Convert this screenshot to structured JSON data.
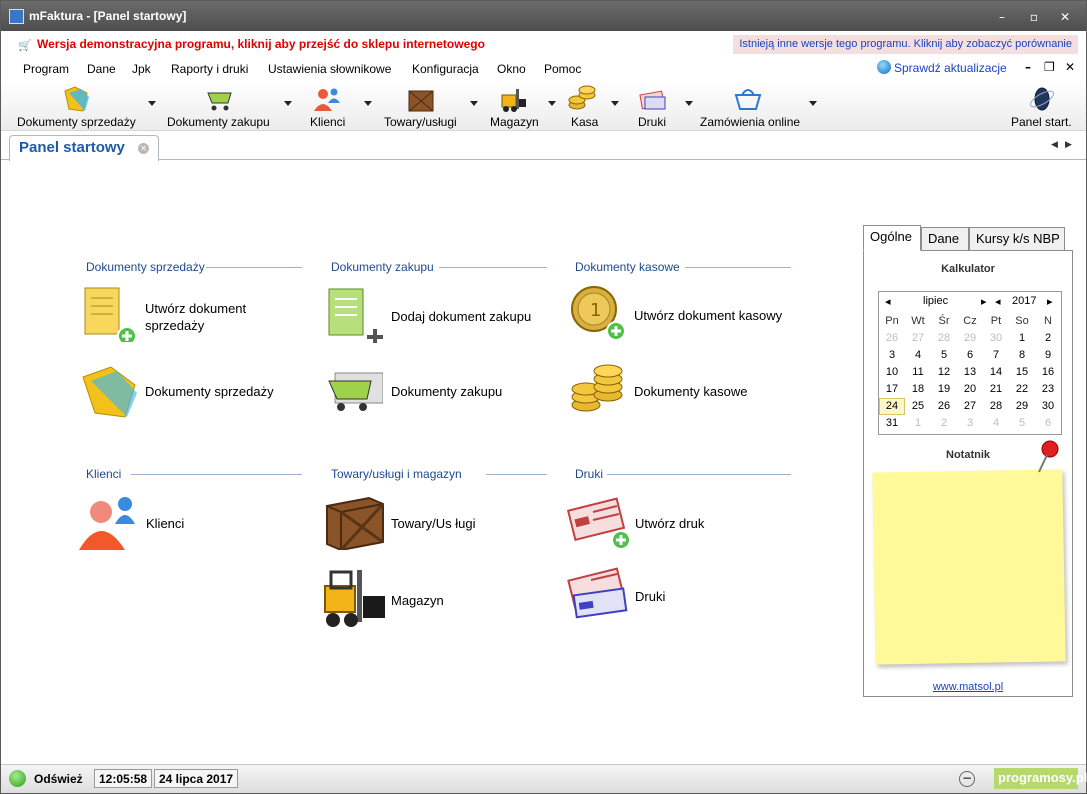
{
  "window": {
    "title": "mFaktura - [Panel startowy]"
  },
  "demo": {
    "link": "Wersja demonstracyjna programu, kliknij aby przejść do sklepu internetowego",
    "compare": "Istnieją inne wersje tego programu. Kliknij aby zobaczyć porównanie"
  },
  "menu": {
    "items": [
      "Program",
      "Dane",
      "Jpk",
      "Raporty i druki",
      "Ustawienia słownikowe",
      "Konfiguracja",
      "Okno",
      "Pomoc"
    ],
    "update": "Sprawdź aktualizacje"
  },
  "toolbar": {
    "buttons": [
      "Dokumenty sprzedaży",
      "Dokumenty zakupu",
      "Klienci",
      "Towary/usługi",
      "Magazyn",
      "Kasa",
      "Druki",
      "Zamówienia online",
      "Panel start."
    ]
  },
  "tabs": {
    "active": "Panel startowy"
  },
  "sections": {
    "sales": {
      "title": "Dokumenty sprzedaży",
      "create": "Utwórz dokument\nsprzedaży",
      "list": "Dokumenty sprzedaży"
    },
    "purchase": {
      "title": "Dokumenty zakupu",
      "create": "Dodaj dokument zakupu",
      "list": "Dokumenty zakupu"
    },
    "cash": {
      "title": "Dokumenty kasowe",
      "create": "Utwórz dokument kasowy",
      "list": "Dokumenty kasowe"
    },
    "clients": {
      "title": "Klienci",
      "list": "Klienci"
    },
    "goods": {
      "title": "Towary/usługi i magazyn",
      "goods": "Towary/Us ługi",
      "warehouse": "Magazyn"
    },
    "prints": {
      "title": "Druki",
      "create": "Utwórz druk",
      "list": "Druki"
    }
  },
  "panel": {
    "tabs": [
      "Ogólne",
      "Dane",
      "Kursy k/s NBP"
    ],
    "calculator": "Kalkulator",
    "calendar": {
      "month": "lipiec",
      "year": "2017",
      "weekdays": [
        "Pn",
        "Wt",
        "Śr",
        "Cz",
        "Pt",
        "So",
        "N"
      ],
      "weeks": [
        [
          "26",
          "27",
          "28",
          "29",
          "30",
          "1",
          "2"
        ],
        [
          "3",
          "4",
          "5",
          "6",
          "7",
          "8",
          "9"
        ],
        [
          "10",
          "11",
          "12",
          "13",
          "14",
          "15",
          "16"
        ],
        [
          "17",
          "18",
          "19",
          "20",
          "21",
          "22",
          "23"
        ],
        [
          "24",
          "25",
          "26",
          "27",
          "28",
          "29",
          "30"
        ],
        [
          "31",
          "1",
          "2",
          "3",
          "4",
          "5",
          "6"
        ]
      ],
      "today": "24"
    },
    "notes": "Notatnik",
    "link": "www.matsol.pl"
  },
  "status": {
    "refresh": "Odśwież",
    "time": "12:05:58",
    "date": "24 lipca 2017",
    "brand": "programosy.pl"
  },
  "colors": {
    "accent": "#1e5aa8",
    "demo": "#e00000",
    "link": "#1a44c2"
  }
}
